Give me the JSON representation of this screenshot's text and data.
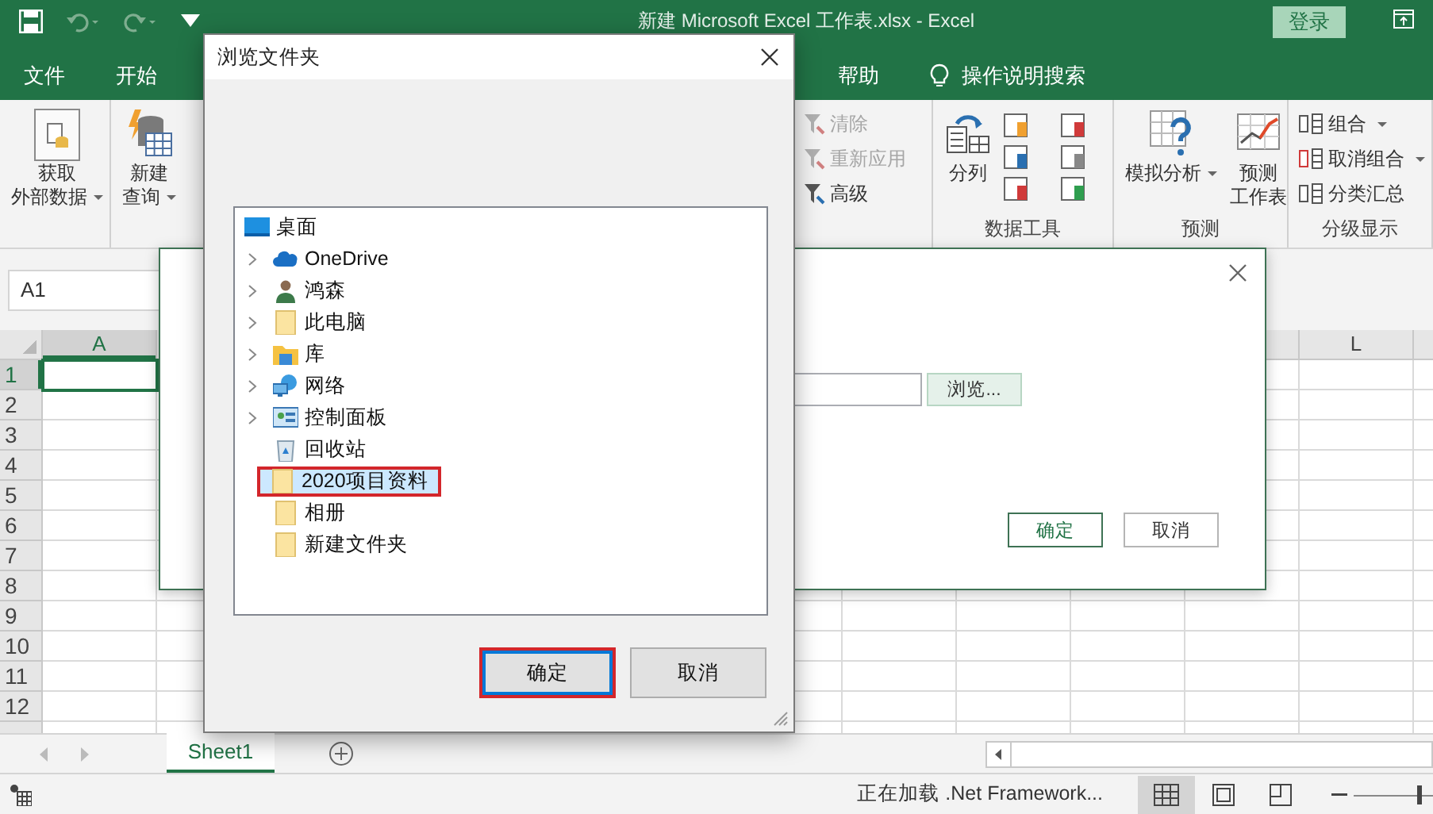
{
  "title_bar": {
    "title": "新建 Microsoft Excel 工作表.xlsx  -  Excel",
    "login_button": "登录"
  },
  "menu_tabs": [
    {
      "label": "文件",
      "selected": false
    },
    {
      "label": "开始",
      "selected": false
    },
    {
      "label": "帮助",
      "selected": false
    }
  ],
  "tell_me": "操作说明搜索",
  "ribbon": {
    "left_buttons": [
      {
        "kind": "get-data",
        "lines": [
          "获取",
          "外部数据"
        ],
        "dropdown": true
      },
      {
        "kind": "new-query",
        "lines": [
          "新建",
          "查询"
        ],
        "dropdown": true
      }
    ],
    "filter_items": [
      {
        "label": "清除",
        "disabled": true
      },
      {
        "label": "重新应用",
        "disabled": true
      },
      {
        "label": "高级",
        "disabled": false
      }
    ],
    "groups": [
      {
        "kind": "data-tools",
        "label": "数据工具",
        "buttons": [
          {
            "kind": "text-to-columns",
            "lines": [
              "分列"
            ],
            "dropdown": false
          }
        ]
      },
      {
        "kind": "forecast",
        "label": "预测",
        "buttons": [
          {
            "kind": "what-if",
            "lines": [
              "模拟分析"
            ],
            "dropdown": true
          },
          {
            "kind": "forecast-sheet",
            "lines": [
              "预测",
              "工作表"
            ],
            "dropdown": false
          }
        ]
      },
      {
        "kind": "outline",
        "label": "分级显示",
        "items": [
          {
            "label": "组合",
            "dropdown": true
          },
          {
            "label": "取消组合",
            "dropdown": true
          },
          {
            "label": "分类汇总",
            "dropdown": false
          }
        ]
      }
    ]
  },
  "name_box": "A1",
  "grid": {
    "columns": [
      {
        "label": "A",
        "selected": true
      },
      {
        "label": "L",
        "selected": false
      }
    ],
    "rows": [
      {
        "label": "1",
        "selected": true
      },
      {
        "label": "2",
        "selected": false
      },
      {
        "label": "3",
        "selected": false
      },
      {
        "label": "4",
        "selected": false
      },
      {
        "label": "5",
        "selected": false
      },
      {
        "label": "6",
        "selected": false
      },
      {
        "label": "7",
        "selected": false
      },
      {
        "label": "8",
        "selected": false
      },
      {
        "label": "9",
        "selected": false
      },
      {
        "label": "10",
        "selected": false
      },
      {
        "label": "11",
        "selected": false
      },
      {
        "label": "12",
        "selected": false
      }
    ]
  },
  "sheet_tabs": [
    {
      "label": "Sheet1",
      "selected": true
    }
  ],
  "status_bar": {
    "message": "正在加载 .Net Framework...",
    "views": [
      {
        "kind": "normal",
        "selected": true
      },
      {
        "kind": "page-layout",
        "selected": false
      },
      {
        "kind": "page-break",
        "selected": false
      }
    ],
    "zoom": {
      "level": 0.5
    }
  },
  "back_dialog": {
    "browse_button": "浏览...",
    "buttons": [
      {
        "label": "确定",
        "default": true
      },
      {
        "label": "取消",
        "default": false
      }
    ]
  },
  "folder_dialog": {
    "title": "浏览文件夹",
    "tree": {
      "label": "桌面",
      "kind": "desktop",
      "selected": false,
      "highlighted": false,
      "children": [
        {
          "label": "OneDrive",
          "kind": "cloud",
          "expandable": true,
          "selected": false,
          "highlighted": false
        },
        {
          "label": "鸿森",
          "kind": "user",
          "expandable": true,
          "selected": false,
          "highlighted": false
        },
        {
          "label": "此电脑",
          "kind": "folder",
          "expandable": true,
          "selected": false,
          "highlighted": false
        },
        {
          "label": "库",
          "kind": "library",
          "expandable": true,
          "selected": false,
          "highlighted": false
        },
        {
          "label": "网络",
          "kind": "network",
          "expandable": true,
          "selected": false,
          "highlighted": false
        },
        {
          "label": "控制面板",
          "kind": "control-panel",
          "expandable": true,
          "selected": false,
          "highlighted": false
        },
        {
          "label": "回收站",
          "kind": "recycle-bin",
          "expandable": false,
          "selected": false,
          "highlighted": false
        },
        {
          "label": "2020项目资料",
          "kind": "folder",
          "expandable": false,
          "selected": true,
          "highlighted": true
        },
        {
          "label": "相册",
          "kind": "folder",
          "expandable": false,
          "selected": false,
          "highlighted": false
        },
        {
          "label": "新建文件夹",
          "kind": "folder",
          "expandable": false,
          "selected": false,
          "highlighted": false
        }
      ]
    },
    "buttons": [
      {
        "label": "确定",
        "default": true,
        "highlighted": true
      },
      {
        "label": "取消",
        "default": false,
        "highlighted": false
      }
    ]
  }
}
